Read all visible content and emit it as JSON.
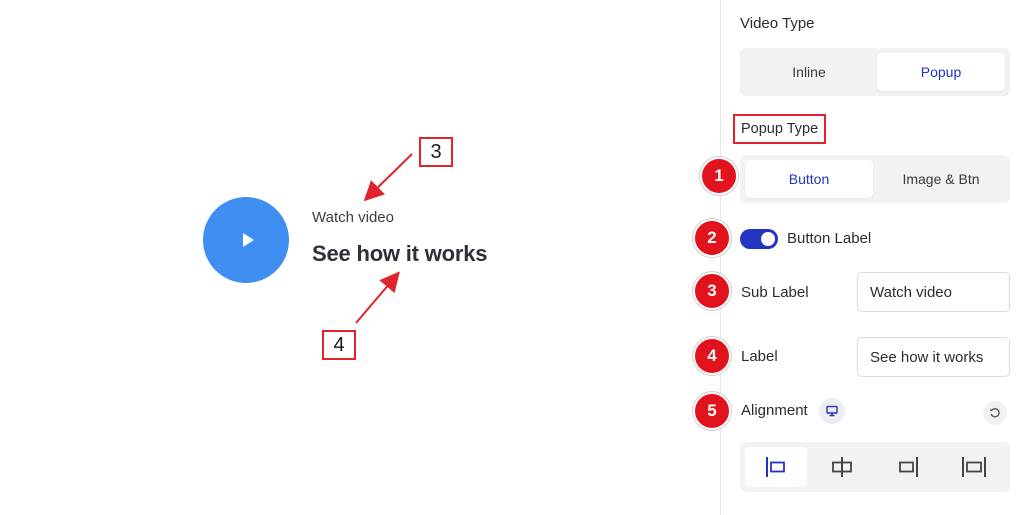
{
  "preview": {
    "sub_label": "Watch video",
    "main_label": "See how it works",
    "callouts": [
      "3",
      "4"
    ],
    "play_icon": "play-icon",
    "accent_color": "#3f8ef2",
    "annotation_color": "#e0242b"
  },
  "panel": {
    "video_type": {
      "heading": "Video Type",
      "options": [
        "Inline",
        "Popup"
      ],
      "selected": "Popup"
    },
    "popup_type": {
      "heading": "Popup Type",
      "options": [
        "Button",
        "Image & Btn"
      ],
      "selected": "Button"
    },
    "button_label": {
      "label": "Button Label",
      "enabled": true
    },
    "sub_label": {
      "label": "Sub Label",
      "value": "Watch video"
    },
    "label": {
      "label": "Label",
      "value": "See how it works"
    },
    "alignment": {
      "label": "Alignment",
      "icons": [
        "align-left-icon",
        "align-center-icon",
        "align-right-icon",
        "align-justify-icon"
      ],
      "selected": "align-left-icon"
    },
    "badges": [
      "1",
      "2",
      "3",
      "4",
      "5"
    ],
    "accent_color": "#2434c2",
    "badge_color": "#e1131c"
  }
}
